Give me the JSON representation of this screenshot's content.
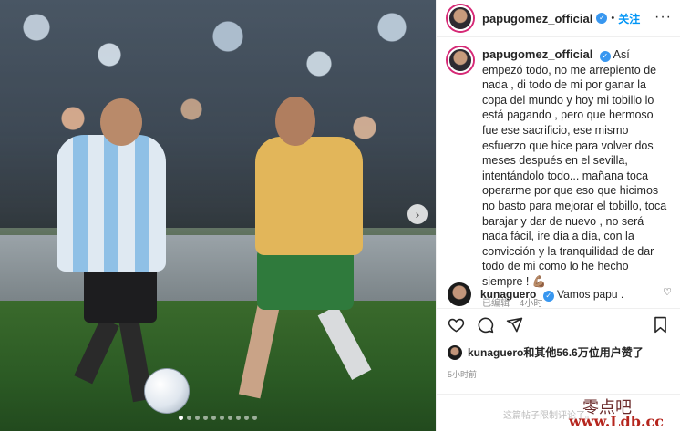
{
  "post": {
    "username": "papugomez_official",
    "follow_label": "关注",
    "more_label": "···"
  },
  "caption": {
    "username": "papugomez_official",
    "text": "Así empezó todo, no me arrepiento de nada , di todo de mi por ganar la copa del mundo y hoy mi tobillo lo está pagando , pero que hermoso fue ese sacrificio, ese mismo esfuerzo que hice para volver dos meses después en el sevilla, intentándolo todo... mañana toca operarme por que eso que hicimos no basto para mejorar el tobillo, toca barajar y dar de nuevo , no será nada fácil, ire día a día, con la convicción y la tranquilidad de dar todo de mi como lo he hecho siempre ! 💪🏽",
    "edited_label": "已编辑",
    "time_ago": "4小时"
  },
  "comment": {
    "username": "kunaguero",
    "text": "Vamos papu ."
  },
  "likes": {
    "text": "kunaguero和其他56.6万位用户赞了"
  },
  "post_time": "5小时前",
  "restricted_notice": "这篇帖子限制评论了。",
  "watermark": {
    "cn": "零点吧",
    "url": "www.Ldb.cc"
  },
  "carousel": {
    "next_icon": "chevron-right-icon",
    "dot_count": 10,
    "active_index": 0
  },
  "icons": {
    "like": "heart-icon",
    "comment": "comment-icon",
    "share": "send-icon",
    "save": "bookmark-icon"
  },
  "colors": {
    "follow": "#0095f6",
    "verified": "#3897f0",
    "watermark": "#b5261e"
  }
}
